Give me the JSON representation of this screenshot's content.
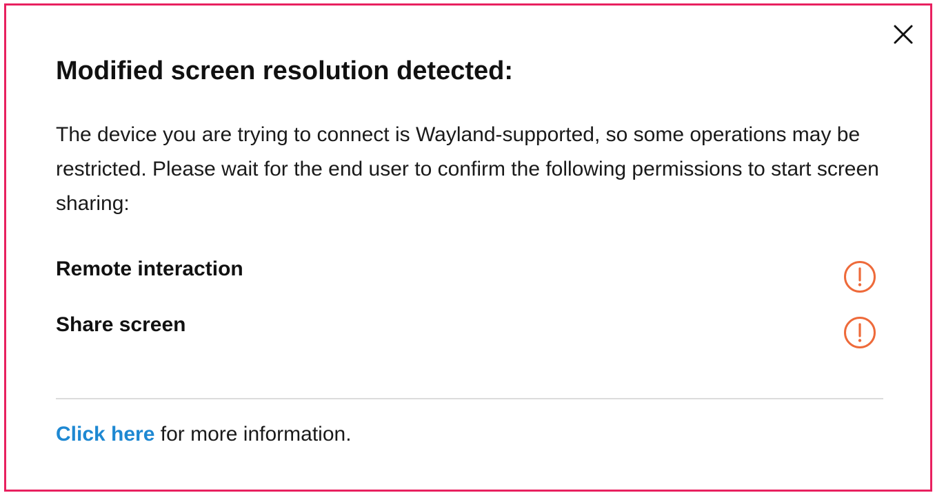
{
  "dialog": {
    "title": "Modified screen resolution detected:",
    "description": "The device you are trying to connect is Wayland-supported, so some operations may be restricted. Please wait for the end user to confirm the following permissions to start screen sharing:",
    "permissions": [
      {
        "label": "Remote interaction",
        "status_icon": "warning-circle-icon"
      },
      {
        "label": "Share screen",
        "status_icon": "warning-circle-icon"
      }
    ],
    "footer": {
      "link_text": "Click here",
      "trailing_text": " for more information."
    },
    "close_icon": "close-icon"
  },
  "colors": {
    "border": "#e8205f",
    "warning": "#ee6a3a",
    "link": "#1e88d2",
    "divider": "#dcdcdc"
  }
}
